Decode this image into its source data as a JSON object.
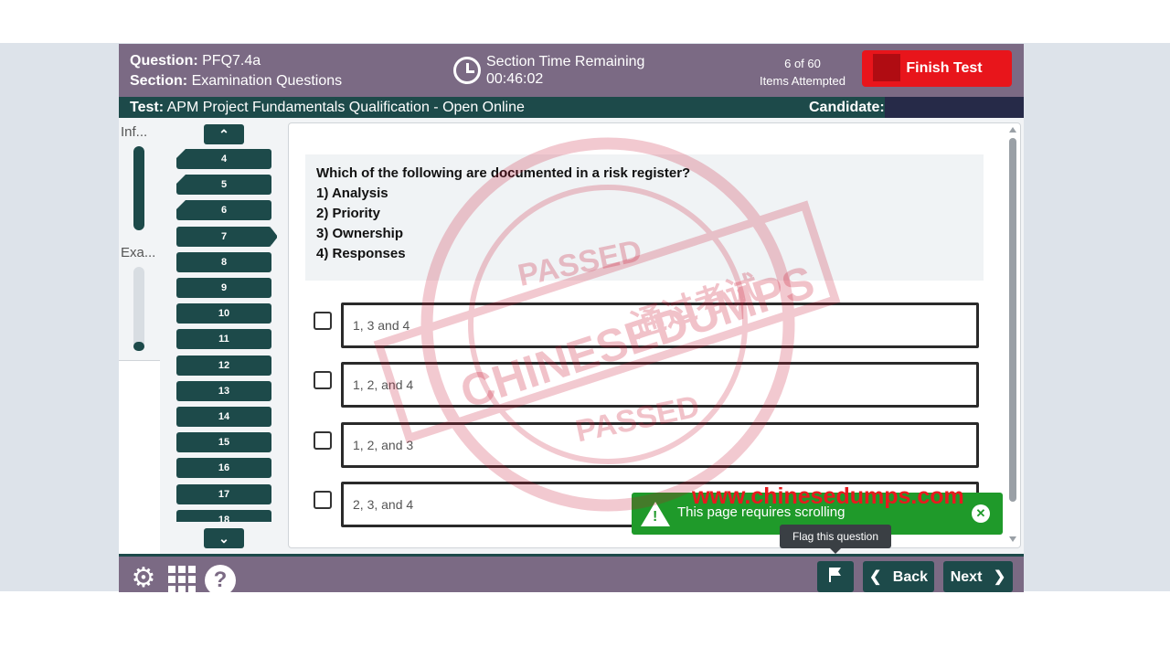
{
  "header": {
    "question_label": "Question:",
    "question_value": "PFQ7.4a",
    "section_label": "Section:",
    "section_value": "Examination Questions",
    "timer_title": "Section Time Remaining",
    "timer_value": "00:46:02",
    "attempted_count": "6 of 60",
    "attempted_label": "Items Attempted",
    "finish_label": "Finish Test"
  },
  "testbar": {
    "test_label": "Test:",
    "test_value": "APM Project Fundamentals Qualification - Open Online",
    "candidate_label": "Candidate:"
  },
  "sidebar": {
    "info_label": "Inf...",
    "exam_label": "Exa..."
  },
  "question_nav": {
    "items": [
      "4",
      "5",
      "6",
      "7",
      "8",
      "9",
      "10",
      "11",
      "12",
      "13",
      "14",
      "15",
      "16",
      "17",
      "18"
    ],
    "current": "7"
  },
  "question": {
    "stem": "Which of the following are documented in a risk register?",
    "items": [
      "1) Analysis",
      "2) Priority",
      "3) Ownership",
      "4) Responses"
    ]
  },
  "options": [
    "1, 3 and 4",
    "1, 2, and 4",
    "1, 2, and 3",
    "2, 3, and 4"
  ],
  "toast": {
    "message": "This page requires scrolling"
  },
  "tooltip": {
    "text": "Flag this question"
  },
  "footer": {
    "back_label": "Back",
    "next_label": "Next"
  },
  "watermark": {
    "passed": "PASSED",
    "brand": "CHINESEDUMPS",
    "chinese": "通过考试",
    "url": "www.chinesedumps.com"
  },
  "colors": {
    "header_purple": "#7b6a84",
    "dark_teal": "#1d4a4a",
    "finish_red": "#e8151b",
    "toast_green": "#1f9a2a",
    "watermark_red": "#e8191e"
  }
}
